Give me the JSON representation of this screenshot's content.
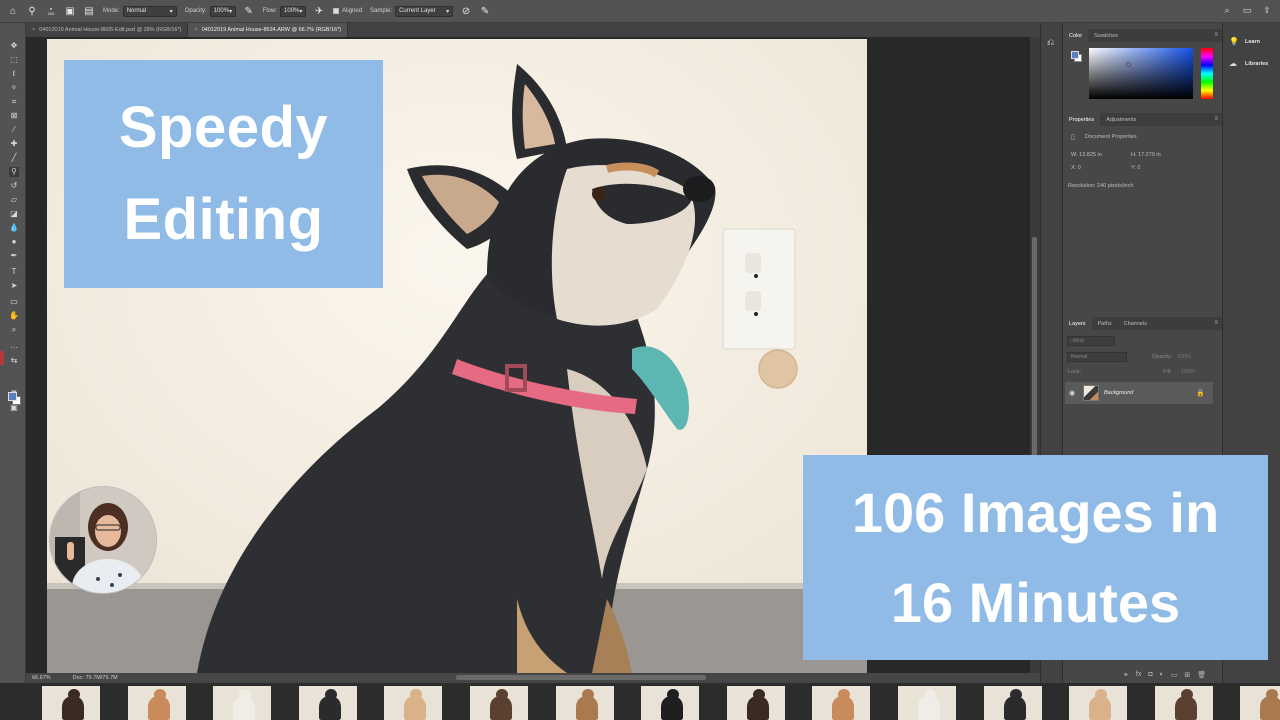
{
  "options_bar": {
    "brush_size": "200",
    "mode_label": "Mode:",
    "mode_value": "Normal",
    "opacity_label": "Opacity:",
    "opacity_value": "100%",
    "flow_label": "Flow:",
    "flow_value": "100%",
    "aligned_label": "Aligned",
    "sample_label": "Sample:",
    "sample_value": "Current Layer"
  },
  "document_tabs": [
    {
      "label": "04012019 Animal House-8605-Edit.psd @ 28% (RGB/16*)"
    },
    {
      "label": "04012019 Animal House-8624.ARW @ 66.7% (RGB/16*)"
    }
  ],
  "status_bar": {
    "zoom": "66.67%",
    "doc_info": "Doc: 79.7M/79.7M"
  },
  "color_panel": {
    "tabs": [
      "Color",
      "Swatches"
    ],
    "foreground": "#5b7fbf",
    "background": "#ffffff"
  },
  "properties_panel": {
    "tabs": [
      "Properties",
      "Adjustments"
    ],
    "section": "Document Properties",
    "w": "W:  13.825 in",
    "h": "H:  17.279 in",
    "x": "X:  0",
    "y": "Y:  0",
    "resolution": "Resolution: 240 pixels/inch"
  },
  "layers_panel": {
    "tabs": [
      "Layers",
      "Paths",
      "Channels"
    ],
    "filter_placeholder": "Kind",
    "blend_mode": "Normal",
    "opacity_label": "Opacity:",
    "opacity_value": "100%",
    "lock_label": "Lock:",
    "fill_label": "Fill:",
    "fill_value": "100%",
    "layers": [
      {
        "name": "Background"
      }
    ]
  },
  "learn_panel": {
    "items": [
      "Learn",
      "Libraries"
    ]
  },
  "overlays": {
    "top_left_line1": "Speedy",
    "top_left_line2": "Editing",
    "bottom_right_line1": "106 Images in",
    "bottom_right_line2": "16 Minutes"
  },
  "colors": {
    "overlay_blue": "#8fbbe6",
    "ui_dark": "#535353"
  }
}
